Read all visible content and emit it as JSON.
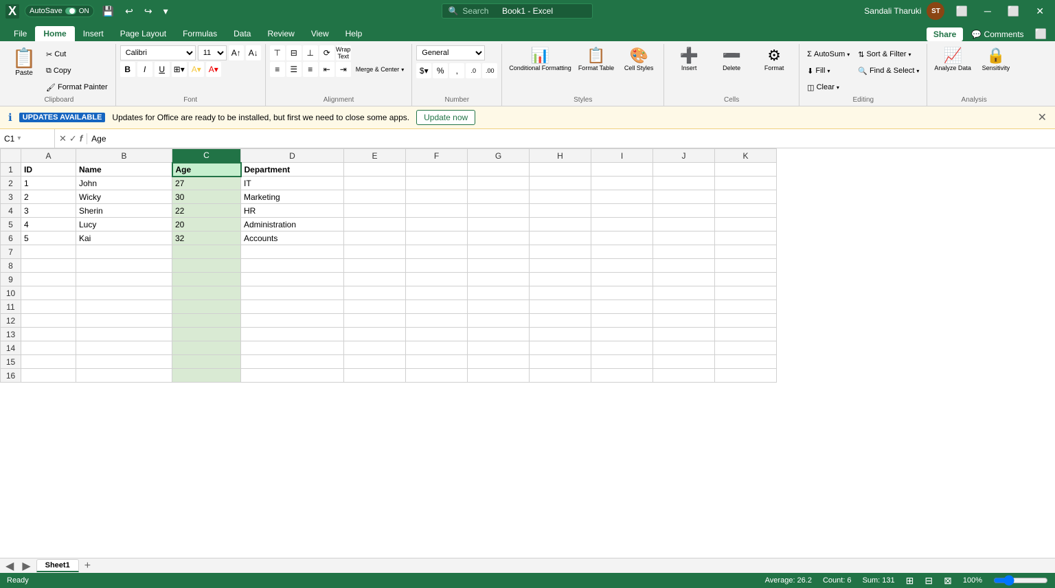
{
  "titleBar": {
    "autosave": "AutoSave",
    "appName": "Book1 - Excel",
    "userName": "Sandali Tharuki",
    "userInitials": "ST",
    "searchPlaceholder": "Search"
  },
  "ribbonTabs": {
    "tabs": [
      "File",
      "Home",
      "Insert",
      "Page Layout",
      "Formulas",
      "Data",
      "Review",
      "View",
      "Help"
    ],
    "activeTab": "Home",
    "shareLabel": "Share",
    "commentsLabel": "Comments"
  },
  "clipboard": {
    "pasteLabel": "Paste",
    "cutLabel": "Cut",
    "copyLabel": "Copy",
    "formatPainterLabel": "Format Painter",
    "groupLabel": "Clipboard"
  },
  "font": {
    "fontName": "Calibri",
    "fontSize": "11",
    "boldLabel": "B",
    "italicLabel": "I",
    "underlineLabel": "U",
    "groupLabel": "Font"
  },
  "alignment": {
    "groupLabel": "Alignment",
    "wrapTextLabel": "Wrap Text",
    "mergeCenterLabel": "Merge & Center"
  },
  "number": {
    "format": "General",
    "groupLabel": "Number"
  },
  "styles": {
    "conditionalFormattingLabel": "Conditional Formatting",
    "formatTableLabel": "Format Table",
    "cellStylesLabel": "Cell Styles",
    "groupLabel": "Styles"
  },
  "cells": {
    "insertLabel": "Insert",
    "deleteLabel": "Delete",
    "formatLabel": "Format",
    "groupLabel": "Cells"
  },
  "editing": {
    "autoSumLabel": "AutoSum",
    "fillLabel": "Fill",
    "clearLabel": "Clear",
    "sortFilterLabel": "Sort & Filter",
    "findSelectLabel": "Find & Select",
    "groupLabel": "Editing"
  },
  "analysis": {
    "analyzeDataLabel": "Analyze Data",
    "sensitivityLabel": "Sensitivity",
    "groupLabel": "Analysis"
  },
  "updateBar": {
    "iconLabel": "ℹ",
    "badgeLabel": "UPDATES AVAILABLE",
    "message": "Updates for Office are ready to be installed, but first we need to close some apps.",
    "buttonLabel": "Update now"
  },
  "formulaBar": {
    "cellRef": "C1",
    "formula": "Age"
  },
  "spreadsheet": {
    "columns": [
      "",
      "A",
      "B",
      "C",
      "D",
      "E",
      "F",
      "G",
      "H",
      "I",
      "J",
      "K"
    ],
    "rows": [
      {
        "num": 1,
        "cells": [
          "ID",
          "Name",
          "Age",
          "Department",
          "",
          "",
          "",
          "",
          "",
          "",
          ""
        ]
      },
      {
        "num": 2,
        "cells": [
          "1",
          "John",
          "27",
          "IT",
          "",
          "",
          "",
          "",
          "",
          "",
          ""
        ]
      },
      {
        "num": 3,
        "cells": [
          "2",
          "Wicky",
          "30",
          "Marketing",
          "",
          "",
          "",
          "",
          "",
          "",
          ""
        ]
      },
      {
        "num": 4,
        "cells": [
          "3",
          "Sherin",
          "22",
          "HR",
          "",
          "",
          "",
          "",
          "",
          "",
          ""
        ]
      },
      {
        "num": 5,
        "cells": [
          "4",
          "Lucy",
          "20",
          "Administration",
          "",
          "",
          "",
          "",
          "",
          "",
          ""
        ]
      },
      {
        "num": 6,
        "cells": [
          "5",
          "Kai",
          "32",
          "Accounts",
          "",
          "",
          "",
          "",
          "",
          "",
          ""
        ]
      },
      {
        "num": 7,
        "cells": [
          "",
          "",
          "",
          "",
          "",
          "",
          "",
          "",
          "",
          "",
          ""
        ]
      },
      {
        "num": 8,
        "cells": [
          "",
          "",
          "",
          "",
          "",
          "",
          "",
          "",
          "",
          "",
          ""
        ]
      },
      {
        "num": 9,
        "cells": [
          "",
          "",
          "",
          "",
          "",
          "",
          "",
          "",
          "",
          "",
          ""
        ]
      },
      {
        "num": 10,
        "cells": [
          "",
          "",
          "",
          "",
          "",
          "",
          "",
          "",
          "",
          "",
          ""
        ]
      },
      {
        "num": 11,
        "cells": [
          "",
          "",
          "",
          "",
          "",
          "",
          "",
          "",
          "",
          "",
          ""
        ]
      },
      {
        "num": 12,
        "cells": [
          "",
          "",
          "",
          "",
          "",
          "",
          "",
          "",
          "",
          "",
          ""
        ]
      },
      {
        "num": 13,
        "cells": [
          "",
          "",
          "",
          "",
          "",
          "",
          "",
          "",
          "",
          "",
          ""
        ]
      },
      {
        "num": 14,
        "cells": [
          "",
          "",
          "",
          "",
          "",
          "",
          "",
          "",
          "",
          "",
          ""
        ]
      },
      {
        "num": 15,
        "cells": [
          "",
          "",
          "",
          "",
          "",
          "",
          "",
          "",
          "",
          "",
          ""
        ]
      },
      {
        "num": 16,
        "cells": [
          "",
          "",
          "",
          "",
          "",
          "",
          "",
          "",
          "",
          "",
          ""
        ]
      }
    ],
    "selectedCell": "C1",
    "activeSheet": "Sheet1"
  },
  "statusBar": {
    "readyLabel": "Ready",
    "averageLabel": "Average: 26.2",
    "countLabel": "Count: 6",
    "sumLabel": "Sum: 131"
  }
}
